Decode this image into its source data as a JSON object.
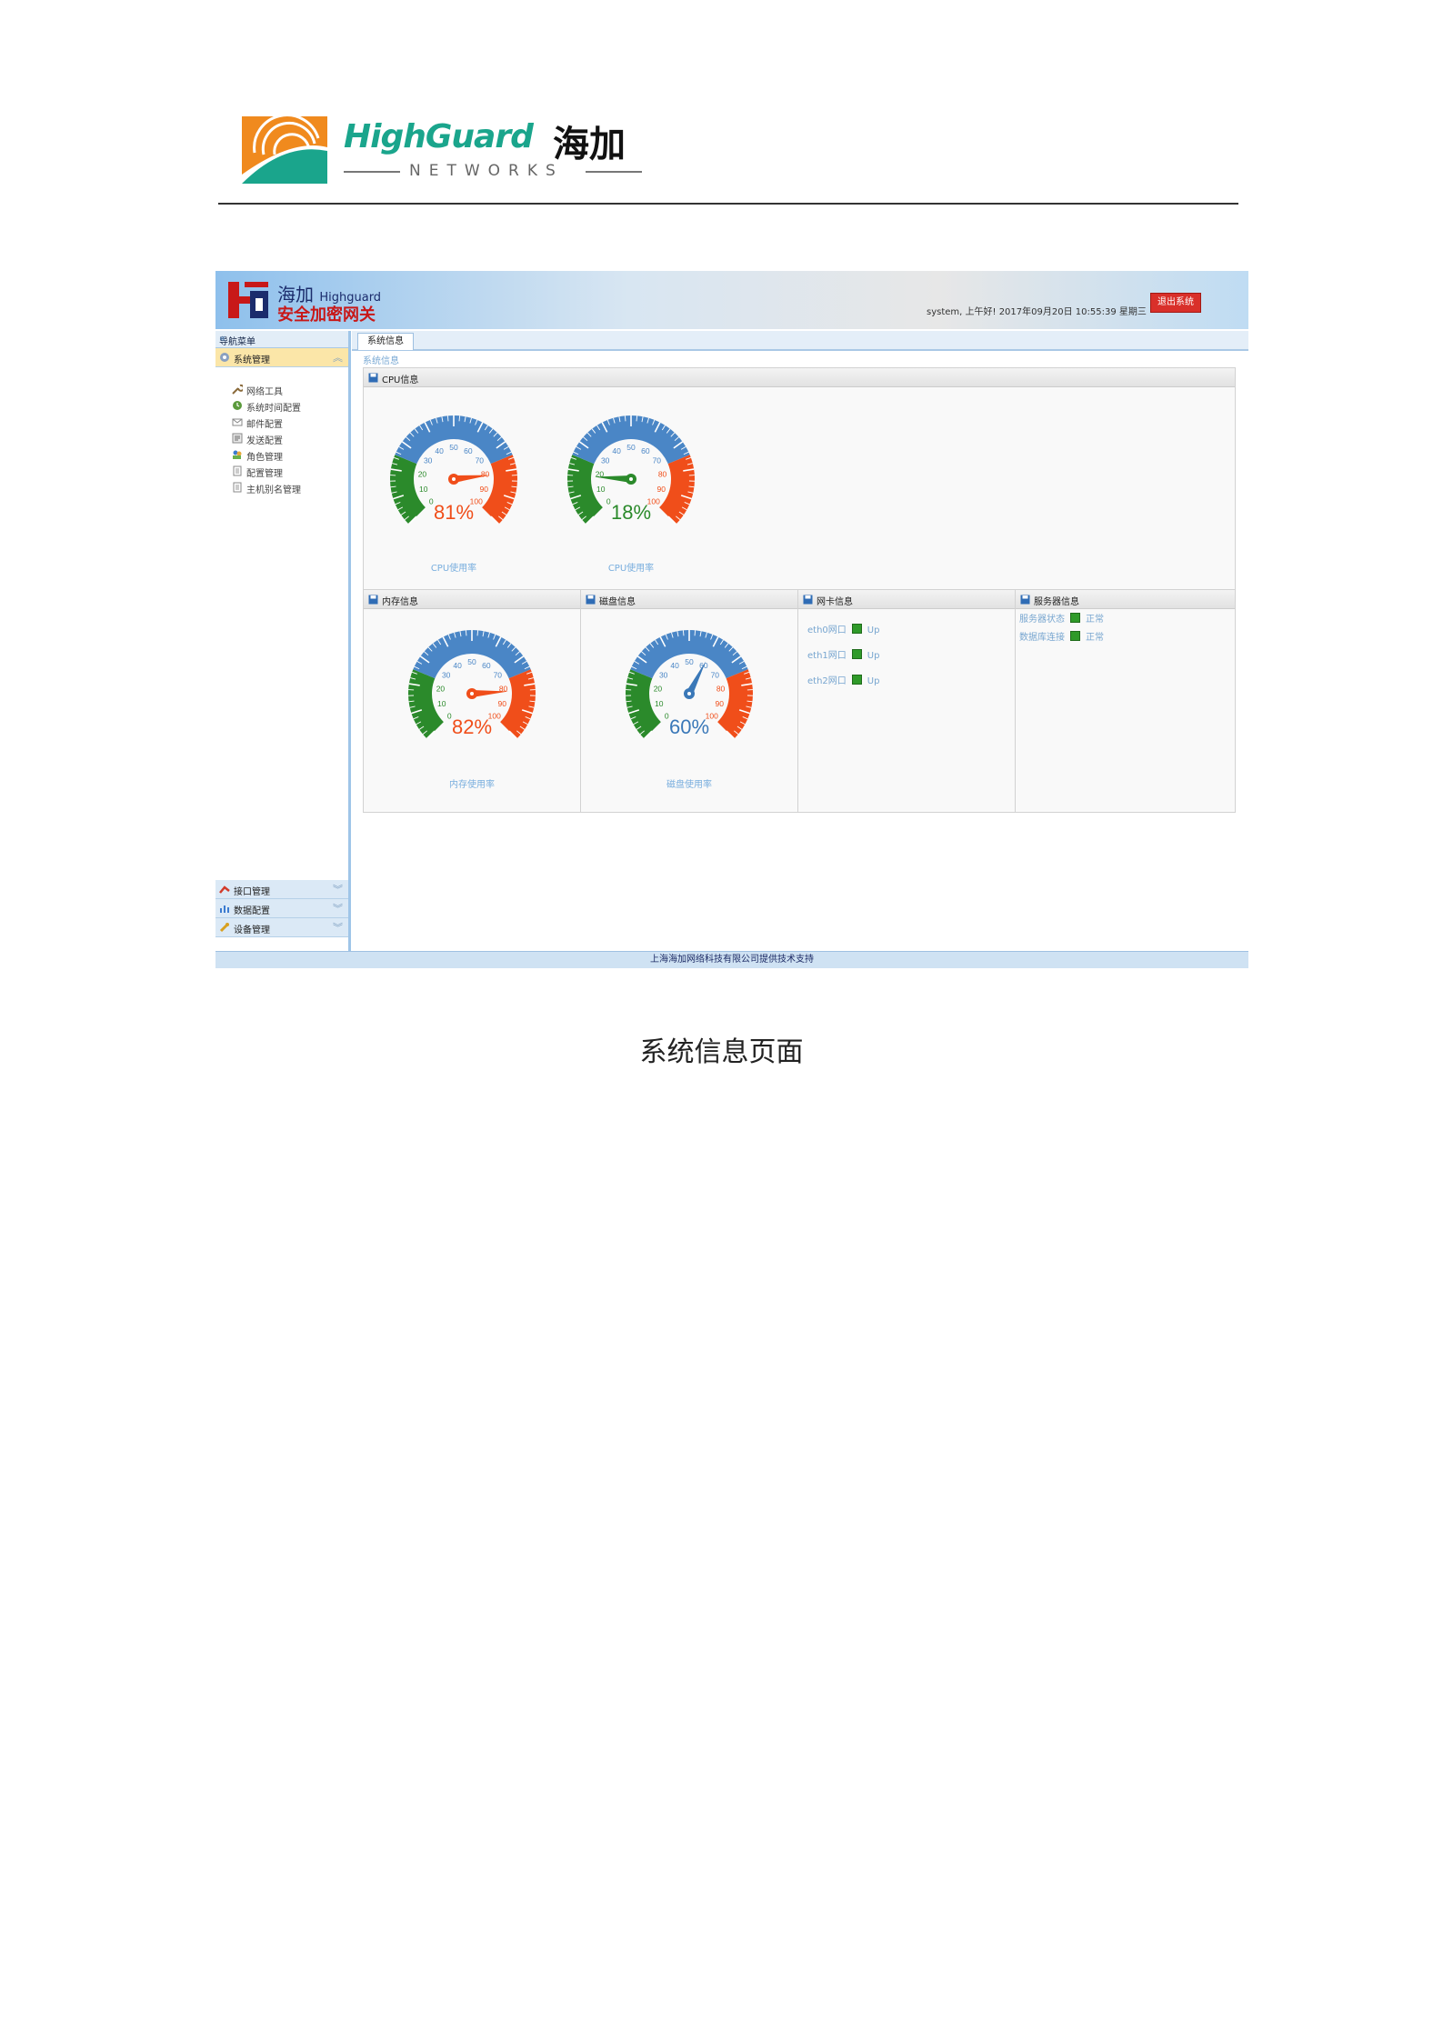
{
  "doc_header": {
    "brand_en": "HighGuard",
    "brand_cn": "海加",
    "brand_tagline": "NETWORKS"
  },
  "app": {
    "name_cn": "海加",
    "name_en": "Highguard",
    "subtitle": "安全加密网关",
    "user_info": "system, 上午好! 2017年09月20日 10:55:39 星期三",
    "logout_label": "退出系统",
    "footer": "上海海加网络科技有限公司提供技术支持"
  },
  "nav": {
    "title": "导航菜单",
    "active_group": "系统管理",
    "items": [
      {
        "label": "网络工具",
        "icon": "wrench-icon"
      },
      {
        "label": "系统时间配置",
        "icon": "clock-icon"
      },
      {
        "label": "邮件配置",
        "icon": "mail-icon"
      },
      {
        "label": "发送配置",
        "icon": "send-icon"
      },
      {
        "label": "角色管理",
        "icon": "users-icon"
      },
      {
        "label": "配置管理",
        "icon": "document-icon"
      },
      {
        "label": "主机别名管理",
        "icon": "document-icon"
      }
    ],
    "groups_bottom": [
      {
        "label": "接口管理",
        "icon": "interface-icon"
      },
      {
        "label": "数据配置",
        "icon": "data-icon"
      },
      {
        "label": "设备管理",
        "icon": "device-icon"
      }
    ]
  },
  "main": {
    "tab_label": "系统信息",
    "breadcrumb": "系统信息",
    "panels": {
      "cpu": {
        "title": "CPU信息",
        "gauges": [
          {
            "caption": "CPU使用率",
            "value": 81,
            "value_text": "81%"
          },
          {
            "caption": "CPU使用率",
            "value": 18,
            "value_text": "18%"
          }
        ]
      },
      "memory": {
        "title": "内存信息",
        "gauge": {
          "caption": "内存使用率",
          "value": 82,
          "value_text": "82%"
        }
      },
      "disk": {
        "title": "磁盘信息",
        "gauge": {
          "caption": "磁盘使用率",
          "value": 60,
          "value_text": "60%"
        }
      },
      "nic": {
        "title": "网卡信息",
        "rows": [
          {
            "name": "eth0网口",
            "status": "Up"
          },
          {
            "name": "eth1网口",
            "status": "Up"
          },
          {
            "name": "eth2网口",
            "status": "Up"
          }
        ]
      },
      "server": {
        "title": "服务器信息",
        "rows": [
          {
            "name": "服务器状态",
            "status": "正常"
          },
          {
            "name": "数据库连接",
            "status": "正常"
          }
        ]
      }
    },
    "gauge_ticks": [
      "0",
      "10",
      "20",
      "30",
      "40",
      "50",
      "60",
      "70",
      "80",
      "90",
      "100"
    ]
  },
  "caption": "系统信息页面",
  "colors": {
    "gauge_low": "#2b8a2b",
    "gauge_mid": "#4a86c6",
    "gauge_high": "#f04e1a",
    "gauge_blue_text": "#3a78b8",
    "accent_teal": "#1aa58c",
    "logout_red": "#d9302a"
  }
}
